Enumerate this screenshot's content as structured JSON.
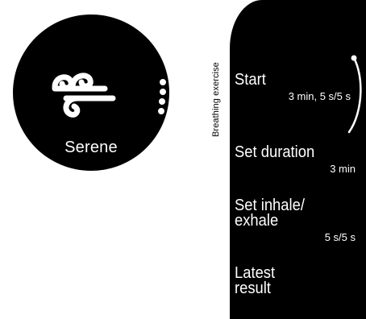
{
  "watch_face": {
    "label": "Serene",
    "icon": "wind-swirl-icon",
    "page_dots": 4
  },
  "menu": {
    "title": "Breathing exercise",
    "items": [
      {
        "label": "Start",
        "value": "3 min, 5 s/5 s"
      },
      {
        "label": "Set duration",
        "value": "3 min"
      },
      {
        "label_line1": "Set inhale/",
        "label_line2": "exhale",
        "value": "5 s/5 s"
      },
      {
        "label_line1": "Latest",
        "label_line2": "result"
      }
    ]
  },
  "colors": {
    "background": "#ffffff",
    "screen": "#000000",
    "text": "#ffffff"
  }
}
